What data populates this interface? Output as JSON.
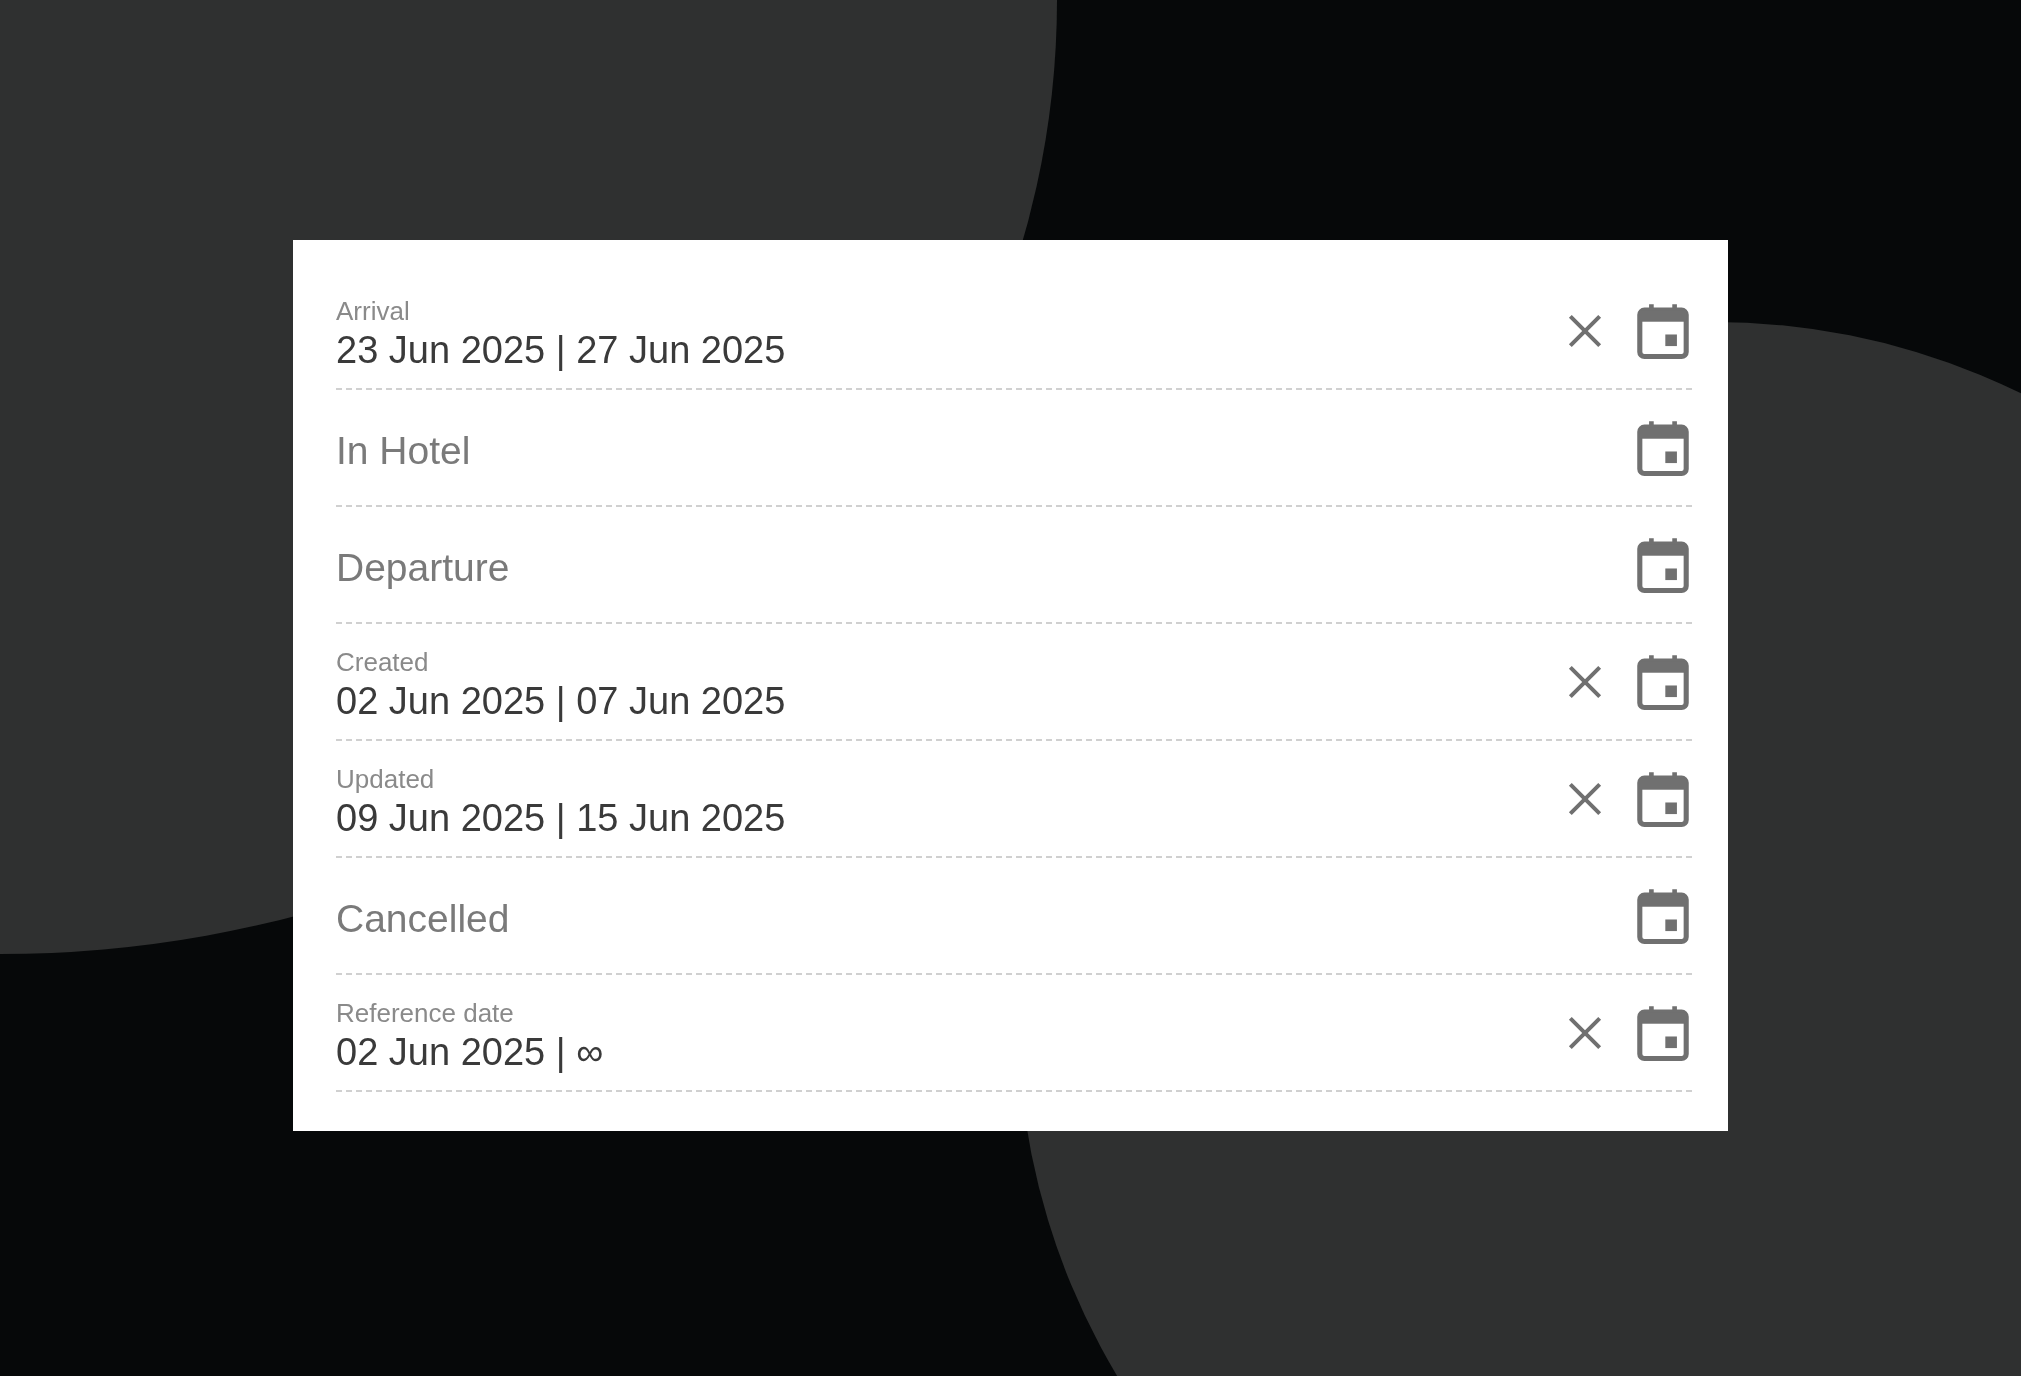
{
  "fields": [
    {
      "label": "Arrival",
      "value": "23 Jun 2025 | 27 Jun 2025"
    },
    {
      "placeholder": "In Hotel"
    },
    {
      "placeholder": "Departure"
    },
    {
      "label": "Created",
      "value": "02 Jun 2025 | 07 Jun 2025"
    },
    {
      "label": "Updated",
      "value": "09 Jun 2025 | 15 Jun 2025"
    },
    {
      "placeholder": "Cancelled"
    },
    {
      "label": "Reference date",
      "value": "02 Jun 2025 | ∞"
    }
  ]
}
